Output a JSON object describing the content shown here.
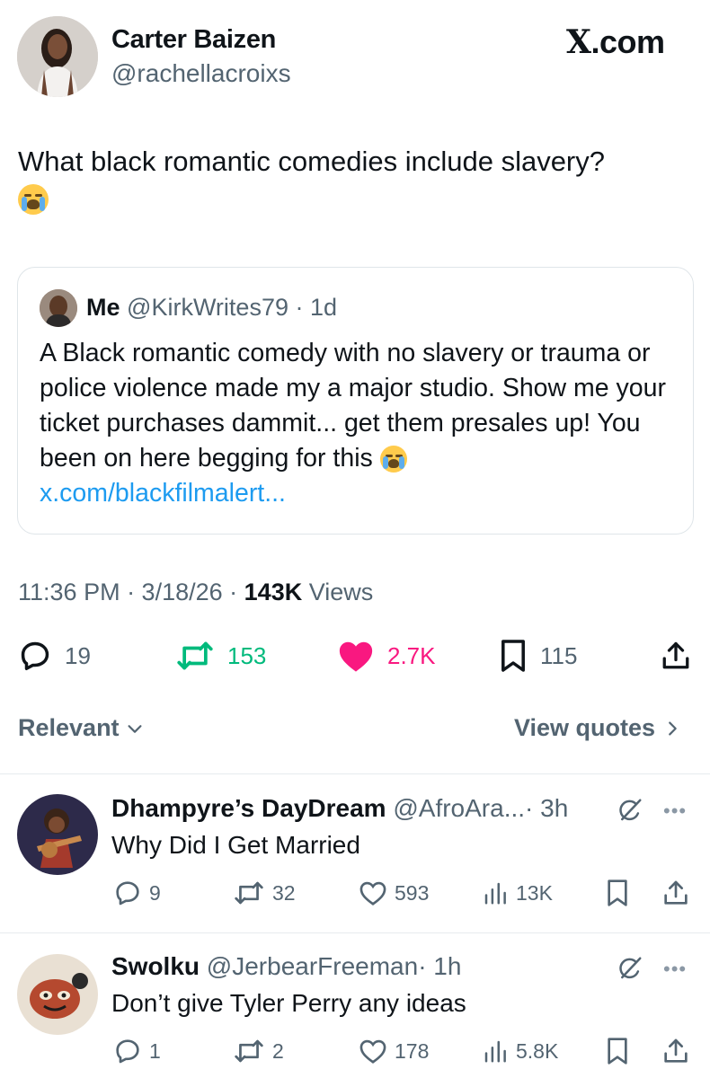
{
  "tweet": {
    "author_name": "Carter Baizen",
    "author_handle": "@rachellacroixs",
    "brand": ".com",
    "brand_mark": "X",
    "text": "What black romantic comedies include slavery?",
    "emoji": "loudly-crying-face",
    "quote": {
      "name": "Me",
      "handle": "@KirkWrites79",
      "time": "· 1d",
      "text": "A Black romantic comedy with no slavery or trauma or police violence made my a major studio. Show me your ticket purchases dammit... get them presales up! You been on here begging for this",
      "link": "x.com/blackfilmalert..."
    },
    "time": "11:36 PM · 3/18/26 ·",
    "views_count": "143K",
    "views_label": "Views",
    "stats": {
      "replies": "19",
      "reposts": "153",
      "likes": "2.7K",
      "bookmarks": "115"
    },
    "colors": {
      "repost": "#00ba7c",
      "like": "#f91880",
      "link": "#1d9bf0"
    }
  },
  "sort": {
    "relevant_label": "Relevant",
    "view_quotes_label": "View quotes"
  },
  "replies": [
    {
      "name": "Dhampyre’s DayDream",
      "handle": "@AfroAra...",
      "time": "· 3h",
      "text": "Why Did I Get Married",
      "stats": {
        "replies": "9",
        "reposts": "32",
        "likes": "593",
        "views": "13K"
      }
    },
    {
      "name": "Swolku",
      "handle": "@JerbearFreeman",
      "time": "· 1h",
      "text": "Don’t give Tyler Perry any ideas",
      "stats": {
        "replies": "1",
        "reposts": "2",
        "likes": "178",
        "views": "5.8K"
      }
    }
  ]
}
